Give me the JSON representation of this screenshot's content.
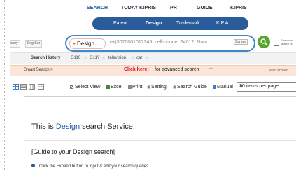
{
  "top_nav": {
    "items": [
      "SEARCH",
      "TODAY KIPRIS",
      "PR",
      "GUIDE",
      "KIPRIS"
    ],
    "active": "SEARCH"
  },
  "sub_nav": {
    "items": [
      "Patent",
      "Design",
      "Trademark",
      "K P A"
    ],
    "active": "Design"
  },
  "search": {
    "query_tag": "Query",
    "engkor_tag": "Eng-Kor",
    "category": "Design",
    "placeholder": "ex)3020001012345, cell-phone, F4012, Nam",
    "spread_label": "Spread",
    "within_line1": "Search w",
    "within_line2": "search re"
  },
  "history": {
    "label": "Search History",
    "items": [
      "G110",
      "G11?",
      "television",
      "car"
    ]
  },
  "smart_search": {
    "label": "Smart Search >",
    "click_here": "Click here!",
    "for_advanced": "for advanced search",
    "auto_scroll": "auto scroll d"
  },
  "toolbar": {
    "select_view": "Select View",
    "excel": "Excel",
    "print": "Print",
    "setting": "Setting",
    "search_guide": "Search Guide",
    "manual": "Manual",
    "per_page": "30 items per page"
  },
  "service": {
    "prefix": "This is ",
    "highlight": "Design",
    "suffix": " search Service."
  },
  "guide": {
    "title": "[Guide to your Design search]",
    "item1": "Click the Expand button to input & edit your search queries."
  },
  "colors": {
    "brand_blue": "#2a5c9c",
    "search_border": "#3e87c8",
    "go_green": "#5aa52f",
    "smart_bg": "#fbe5d9",
    "click_red": "#d4101e"
  }
}
